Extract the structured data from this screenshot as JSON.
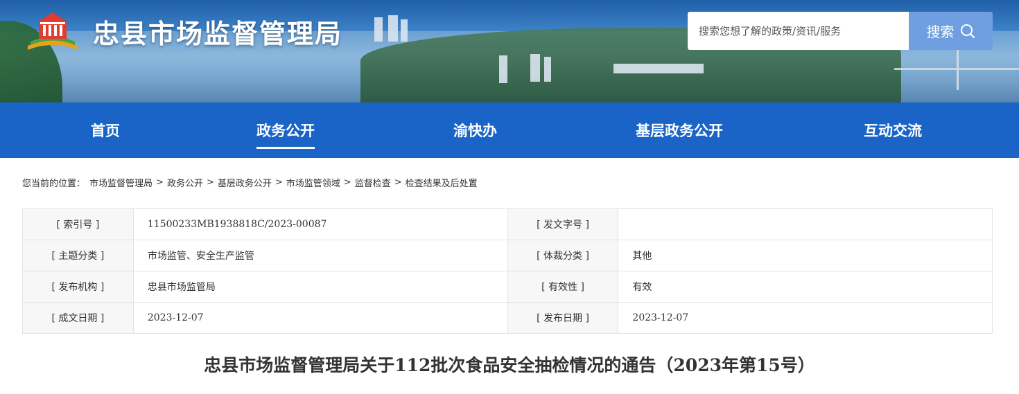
{
  "header": {
    "site_title": "忠县市场监督管理局",
    "search": {
      "placeholder": "搜索您想了解的政策/资讯/服务",
      "button_label": "搜索"
    }
  },
  "nav": {
    "items": [
      {
        "label": "首页"
      },
      {
        "label": "政务公开",
        "active": true
      },
      {
        "label": "渝快办"
      },
      {
        "label": "基层政务公开"
      },
      {
        "label": "互动交流"
      }
    ]
  },
  "breadcrumb": {
    "prefix": "您当前的位置：",
    "items": [
      "市场监督管理局",
      "政务公开",
      "基层政务公开",
      "市场监管领域",
      "监督检查",
      "检查结果及后处置"
    ],
    "separator": ">"
  },
  "info": {
    "rows": [
      {
        "label1": "[ 索引号 ]",
        "value1": "11500233MB1938818C/2023-00087",
        "label2": "[ 发文字号 ]",
        "value2": ""
      },
      {
        "label1": "[ 主题分类 ]",
        "value1": "市场监管、安全生产监管",
        "label2": "[ 体裁分类 ]",
        "value2": "其他"
      },
      {
        "label1": "[ 发布机构 ]",
        "value1": "忠县市场监管局",
        "label2": "[ 有效性 ]",
        "value2": "有效"
      },
      {
        "label1": "[ 成文日期 ]",
        "value1": "2023-12-07",
        "label2": "[ 发布日期 ]",
        "value2": "2023-12-07"
      }
    ]
  },
  "article": {
    "title": "忠县市场监督管理局关于112批次食品安全抽检情况的通告（2023年第15号）"
  },
  "colors": {
    "nav_bg": "#1a63c7",
    "search_button": "#6f9fe0",
    "label_cell_bg": "#f7f7f7"
  }
}
